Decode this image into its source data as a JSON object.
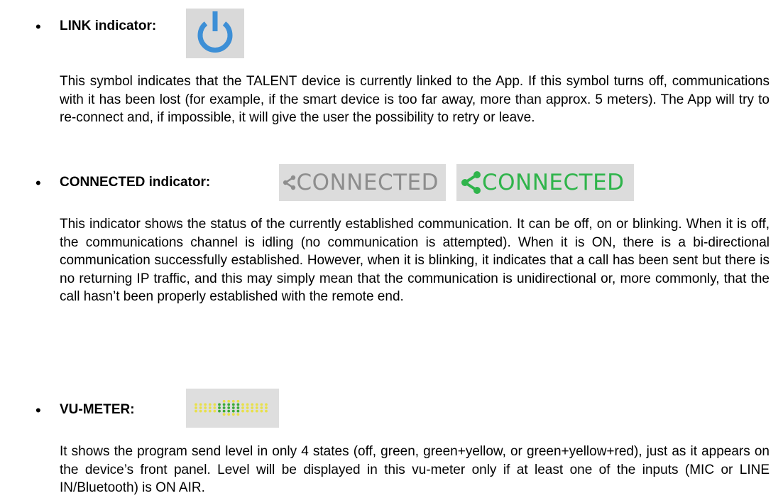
{
  "sections": [
    {
      "bullet": "•",
      "title": "LINK indicator:",
      "icon": "power-icon",
      "text": "This symbol indicates that the TALENT device is currently linked to the App. If this symbol turns off, communications with it has been lost (for example, if the smart device is too far away, more than approx. 5 meters). The App will try to re-connect and, if impossible, it will give the user the possibility to retry or leave."
    },
    {
      "bullet": "•",
      "title": "CONNECTED indicator:",
      "icon": "share-icon",
      "indicator_off_label": "CONNECTED",
      "indicator_on_label": "CONNECTED",
      "text": "This indicator shows the status of the currently established communication. It can be off, on or blinking. When it is off, the communications channel is idling (no communication is attempted). When it is ON, there is a bi-directional communication successfully established. However, when it is blinking, it indicates that a call has been sent but there is no returning IP traffic, and this may simply mean that the communication is unidirectional or, more commonly, that the call hasn’t been properly established with the remote end."
    },
    {
      "bullet": "•",
      "title": "VU-METER:",
      "icon": "vu-meter-icon",
      "text": "It shows the program send level in only 4 states (off, green, green+yellow, or green+yellow+red), just as it appears on the device’s front panel. Level will be displayed in this vu-meter only if at least one of the inputs (MIC or LINE IN/Bluetooth) is ON AIR."
    }
  ],
  "colors": {
    "power_blue": "#3d8fd6",
    "connected_gray": "#8d8d8d",
    "connected_green": "#2fb44b",
    "vu_green": "#3aaa35",
    "vu_yellow": "#e8e04a"
  }
}
